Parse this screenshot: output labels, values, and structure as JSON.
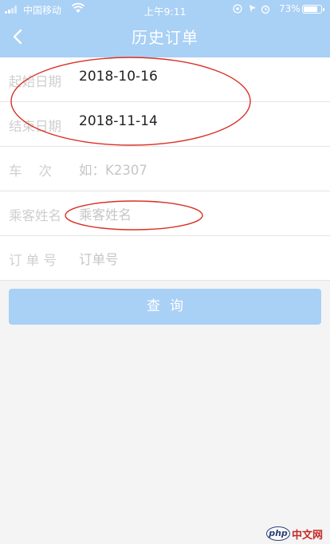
{
  "status_bar": {
    "carrier": "中国移动",
    "time": "上午9:11",
    "battery": "73%",
    "battery_level": 0.73
  },
  "header": {
    "title": "历史订单",
    "back_icon": "chevron-left-icon"
  },
  "form": {
    "start_date": {
      "label": "起始日期",
      "value": "2018-10-16"
    },
    "end_date": {
      "label": "结束日期",
      "value": "2018-11-14"
    },
    "train_no": {
      "label": "车    次",
      "placeholder": "如：K2307"
    },
    "passenger_name": {
      "label": "乘客姓名",
      "placeholder": "乘客姓名"
    },
    "order_no": {
      "label": "订 单 号",
      "placeholder": "订单号"
    }
  },
  "search_button": {
    "label": "查询"
  },
  "watermark": {
    "badge": "php",
    "text": "中文网"
  },
  "colors": {
    "header_bg": "#a9d0f5",
    "button_bg": "#a9d0f5",
    "annotation_red": "#d93025"
  }
}
